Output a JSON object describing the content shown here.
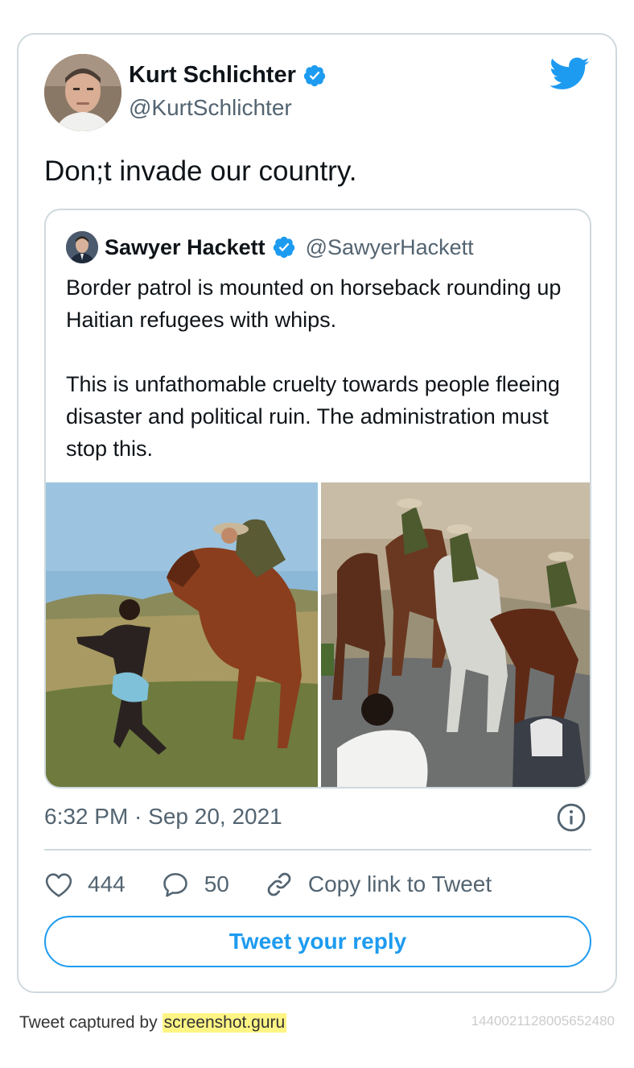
{
  "author": {
    "name": "Kurt Schlichter",
    "handle": "@KurtSchlichter",
    "verified": true,
    "avatar_icon": "profile-photo"
  },
  "tweet": {
    "text": "Don;t invade our country.",
    "timestamp": "6:32 PM · Sep 20, 2021"
  },
  "quoted": {
    "name": "Sawyer Hackett",
    "handle": "@SawyerHackett",
    "verified": true,
    "paragraph1": "Border patrol is mounted on horseback rounding up Haitian refugees with whips.",
    "paragraph2": "This is unfathomable cruelty towards people fleeing disaster and political ruin. The administration must stop this."
  },
  "actions": {
    "likes": "444",
    "replies": "50",
    "copy_link": "Copy link to Tweet"
  },
  "reply_button": "Tweet your reply",
  "footer": {
    "captured_by": "Tweet captured by",
    "brand": "screenshot.guru",
    "tweet_id": "1440021128005652480"
  },
  "colors": {
    "accent": "#1d9bf0",
    "text": "#0f1419",
    "muted": "#536471",
    "border": "#cfd9de",
    "highlight": "#fff584"
  }
}
